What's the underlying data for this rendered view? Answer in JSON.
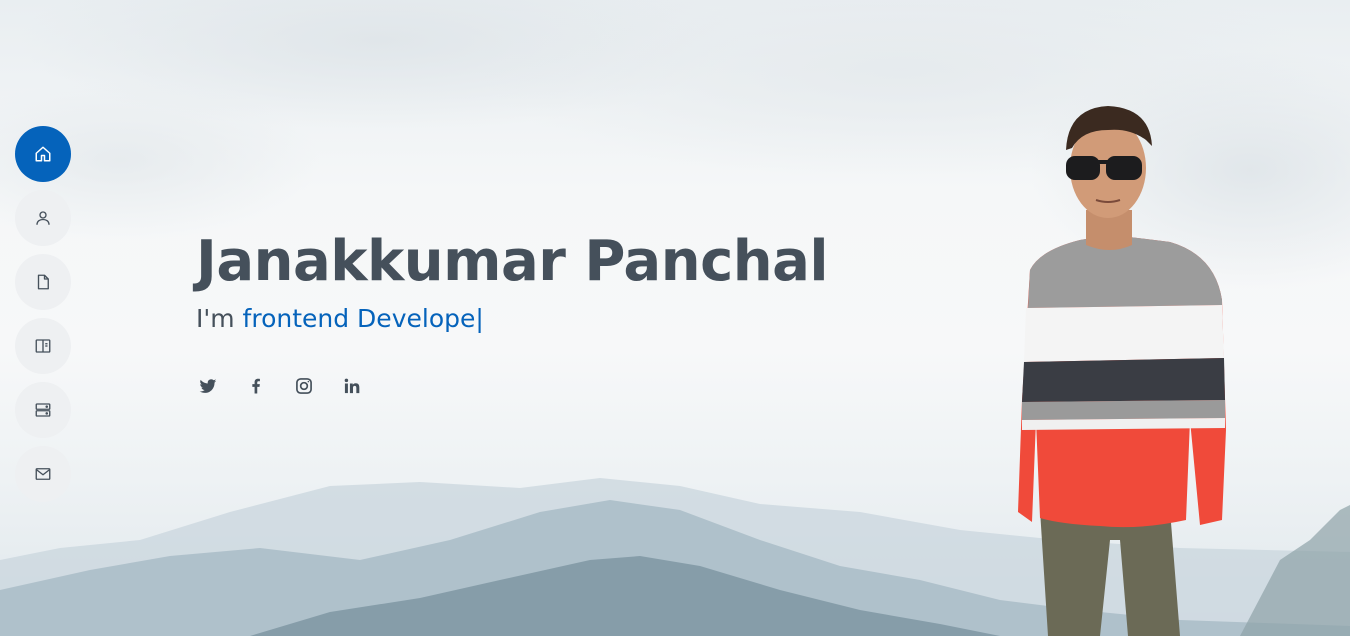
{
  "nav": {
    "items": [
      {
        "icon": "home-icon",
        "active": true
      },
      {
        "icon": "user-icon",
        "active": false
      },
      {
        "icon": "file-icon",
        "active": false
      },
      {
        "icon": "book-icon",
        "active": false
      },
      {
        "icon": "server-icon",
        "active": false
      },
      {
        "icon": "envelope-icon",
        "active": false
      }
    ]
  },
  "hero": {
    "name": "Janakkumar Panchal",
    "prefix": "I'm ",
    "typed": "frontend Develope",
    "cursor": "|"
  },
  "socials": [
    {
      "icon": "twitter-icon"
    },
    {
      "icon": "facebook-icon"
    },
    {
      "icon": "instagram-icon"
    },
    {
      "icon": "linkedin-icon"
    }
  ],
  "colors": {
    "accent": "#0563bb",
    "text": "#45505b",
    "nav_bg": "#eef0f2"
  }
}
